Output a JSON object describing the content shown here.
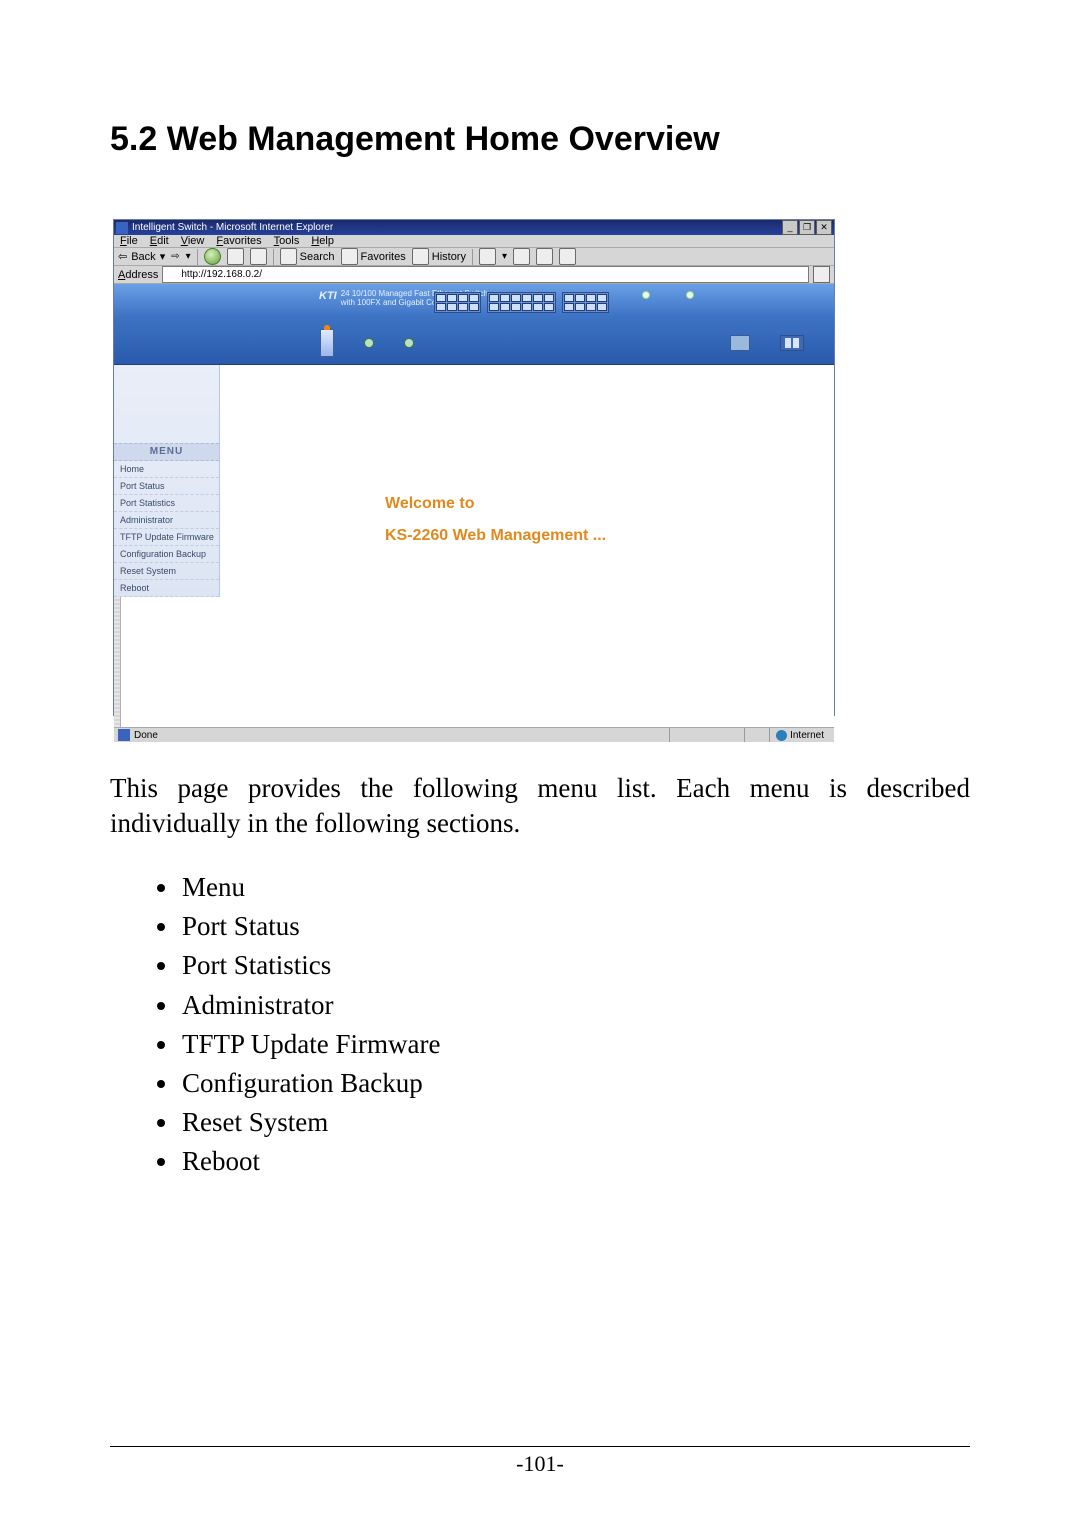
{
  "heading": "5.2 Web Management Home Overview",
  "browser": {
    "title": "Intelligent Switch - Microsoft Internet Explorer",
    "menus": [
      "File",
      "Edit",
      "View",
      "Favorites",
      "Tools",
      "Help"
    ],
    "back_label": "Back",
    "toolbar": {
      "search": "Search",
      "favorites": "Favorites",
      "history": "History"
    },
    "address_label": "Address",
    "address_value": "http://192.168.0.2/",
    "status_done": "Done",
    "status_zone": "Internet"
  },
  "switch_ui": {
    "menu_header": "MENU",
    "menu_items": [
      "Home",
      "Port Status",
      "Port Statistics",
      "Administrator",
      "TFTP Update Firmware",
      "Configuration Backup",
      "Reset System",
      "Reboot"
    ],
    "welcome_line1": "Welcome to",
    "welcome_line2": "KS-2260 Web Management ..."
  },
  "paragraph": "This page provides the following menu list. Each menu is described individually in the following sections.",
  "bullets": [
    "Menu",
    "Port Status",
    "Port Statistics",
    "Administrator",
    "TFTP Update Firmware",
    "Configuration Backup",
    "Reset System",
    "Reboot"
  ],
  "page_number": "-101-"
}
